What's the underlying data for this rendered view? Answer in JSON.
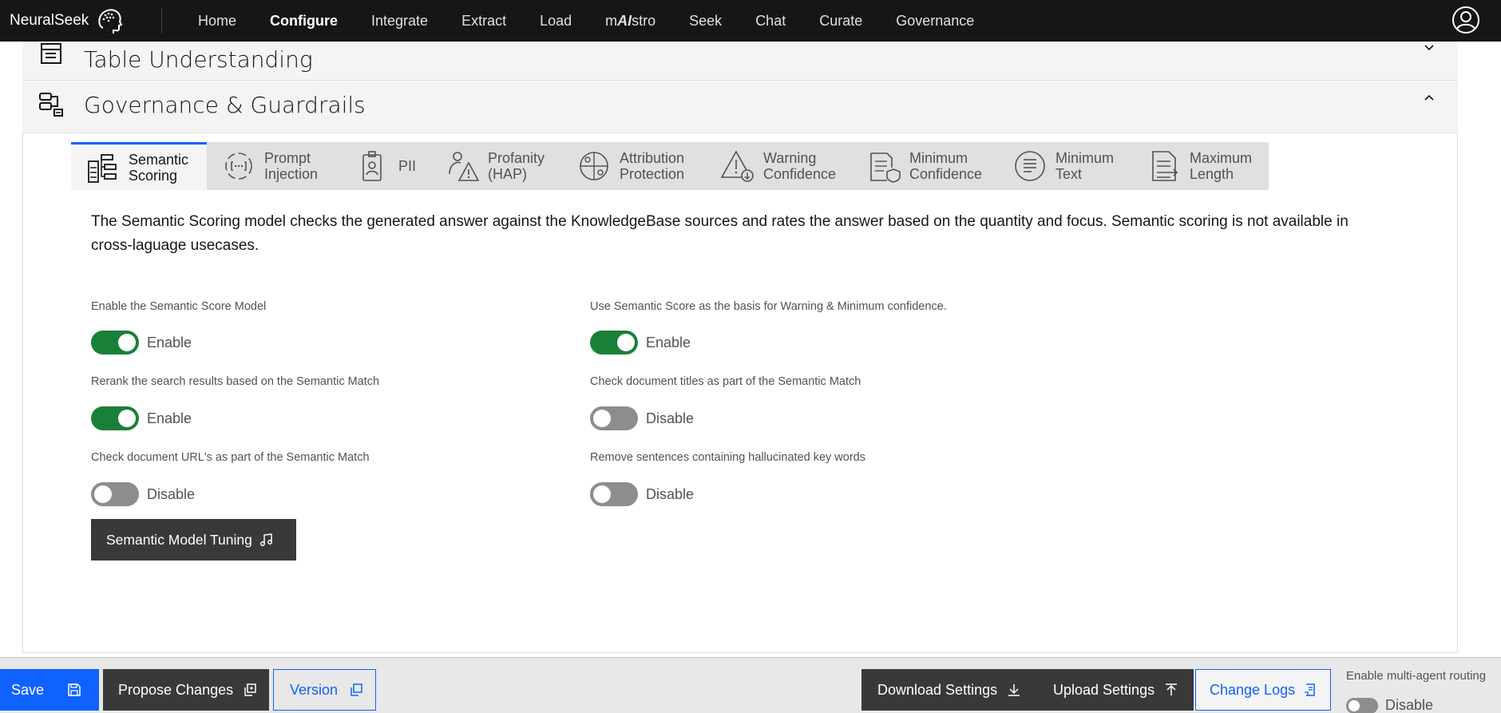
{
  "brand": {
    "name": "NeuralSeek"
  },
  "nav": {
    "items": [
      {
        "label": "Home"
      },
      {
        "label": "Configure",
        "active": true
      },
      {
        "label": "Integrate"
      },
      {
        "label": "Extract"
      },
      {
        "label": "Load"
      },
      {
        "label_pre": "m",
        "label_ai": "AI",
        "label_post": "stro"
      },
      {
        "label": "Seek"
      },
      {
        "label": "Chat"
      },
      {
        "label": "Curate"
      },
      {
        "label": "Governance"
      }
    ]
  },
  "accordion": {
    "table_understanding": {
      "title": "Table Understanding",
      "expanded": false
    },
    "governance": {
      "title": "Governance & Guardrails",
      "expanded": true
    }
  },
  "tabs": [
    {
      "label": "Semantic\nScoring",
      "active": true,
      "icon": "semantic-scoring-icon"
    },
    {
      "label": "Prompt\nInjection",
      "icon": "prompt-injection-icon"
    },
    {
      "label": "PII",
      "icon": "pii-icon"
    },
    {
      "label": "Profanity\n(HAP)",
      "icon": "profanity-icon"
    },
    {
      "label": "Attribution\nProtection",
      "icon": "attribution-icon"
    },
    {
      "label": "Warning\nConfidence",
      "icon": "warning-icon"
    },
    {
      "label": "Minimum\nConfidence",
      "icon": "minimum-confidence-icon"
    },
    {
      "label": "Minimum\nText",
      "icon": "minimum-text-icon"
    },
    {
      "label": "Maximum\nLength",
      "icon": "maximum-length-icon"
    }
  ],
  "semantic": {
    "description": "The Semantic Scoring model checks the generated answer against the KnowledgeBase sources and rates the answer based on the quantity and focus. Semantic scoring is not available in cross-laguage usecases.",
    "fields": [
      {
        "label": "Enable the Semantic Score Model",
        "state": "on",
        "text": "Enable"
      },
      {
        "label": "Use Semantic Score as the basis for Warning & Minimum confidence.",
        "state": "on",
        "text": "Enable"
      },
      {
        "label": "Rerank the search results based on the Semantic Match",
        "state": "on",
        "text": "Enable"
      },
      {
        "label": "Check document titles as part of the Semantic Match",
        "state": "off",
        "text": "Disable"
      },
      {
        "label": "Check document URL's as part of the Semantic Match",
        "state": "off",
        "text": "Disable"
      },
      {
        "label": "Remove sentences containing hallucinated key words",
        "state": "off",
        "text": "Disable"
      }
    ],
    "tuning_button": "Semantic Model Tuning"
  },
  "bottom": {
    "save": "Save",
    "propose": "Propose Changes",
    "version": "Version",
    "download": "Download Settings",
    "upload": "Upload Settings",
    "changelogs": "Change Logs",
    "multi_agent_label": "Enable multi-agent routing",
    "multi_agent_state": "Disable"
  },
  "colors": {
    "nav_bg": "#161616",
    "primary": "#0f62fe",
    "toggle_on": "#198038",
    "toggle_off": "#8d8d8d",
    "dark_button": "#393939"
  }
}
